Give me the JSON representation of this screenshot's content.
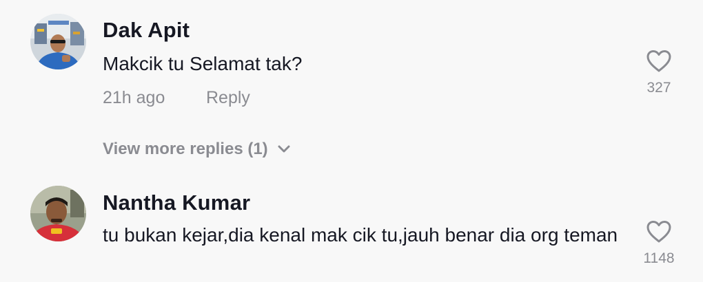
{
  "colors": {
    "background": "#f8f8f8",
    "primary_text": "#161823",
    "secondary_text": "#8a8b91"
  },
  "comments": [
    {
      "avatar_icon": "user-avatar-photo",
      "username": "Dak Apit",
      "text": "Makcik tu Selamat tak?",
      "time": "21h ago",
      "reply_label": "Reply",
      "like_icon": "heart-outline-icon",
      "like_count": "327",
      "view_more_replies": "View more replies (1)"
    },
    {
      "avatar_icon": "user-avatar-photo",
      "username": "Nantha Kumar",
      "text": "tu bukan kejar,dia kenal mak cik tu,jauh benar dia org teman",
      "like_icon": "heart-outline-icon",
      "like_count": "1148"
    }
  ]
}
